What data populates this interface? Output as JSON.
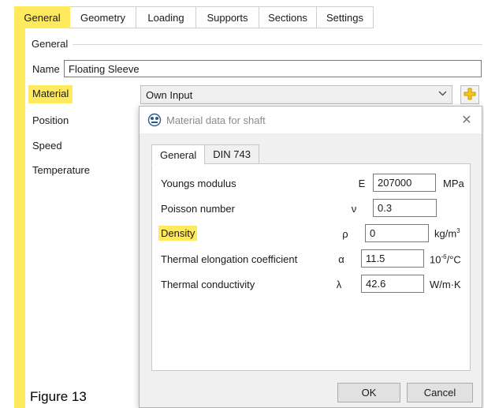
{
  "tabs": [
    "General",
    "Geometry",
    "Loading",
    "Supports",
    "Sections",
    "Settings"
  ],
  "general_group": {
    "title": "General",
    "name_label": "Name",
    "name_value": "Floating Sleeve",
    "material_label": "Material",
    "material_value": "Own Input",
    "position_label": "Position",
    "speed_label": "Speed",
    "temperature_label": "Temperature"
  },
  "dialog": {
    "title": "Material data for shaft",
    "tabs": [
      "General",
      "DIN 743"
    ],
    "rows": [
      {
        "label": "Youngs modulus",
        "symbol": "E",
        "value": "207000",
        "unit": "MPa"
      },
      {
        "label": "Poisson number",
        "symbol": "ν",
        "value": "0.3",
        "unit": ""
      },
      {
        "label": "Density",
        "symbol": "ρ",
        "value": "0",
        "unit_base": "kg/m",
        "unit_sup": "3"
      },
      {
        "label": "Thermal elongation coefficient",
        "symbol": "α",
        "value": "11.5",
        "unit_base": "10",
        "unit_sup": "-6",
        "unit_tail": "/°C"
      },
      {
        "label": "Thermal conductivity",
        "symbol": "λ",
        "value": "42.6",
        "unit": "W/m·K"
      }
    ],
    "ok_label": "OK",
    "cancel_label": "Cancel"
  },
  "caption": "Figure 13",
  "colors": {
    "highlight": "#ffe95c",
    "plus_icon": "#f5c518"
  }
}
